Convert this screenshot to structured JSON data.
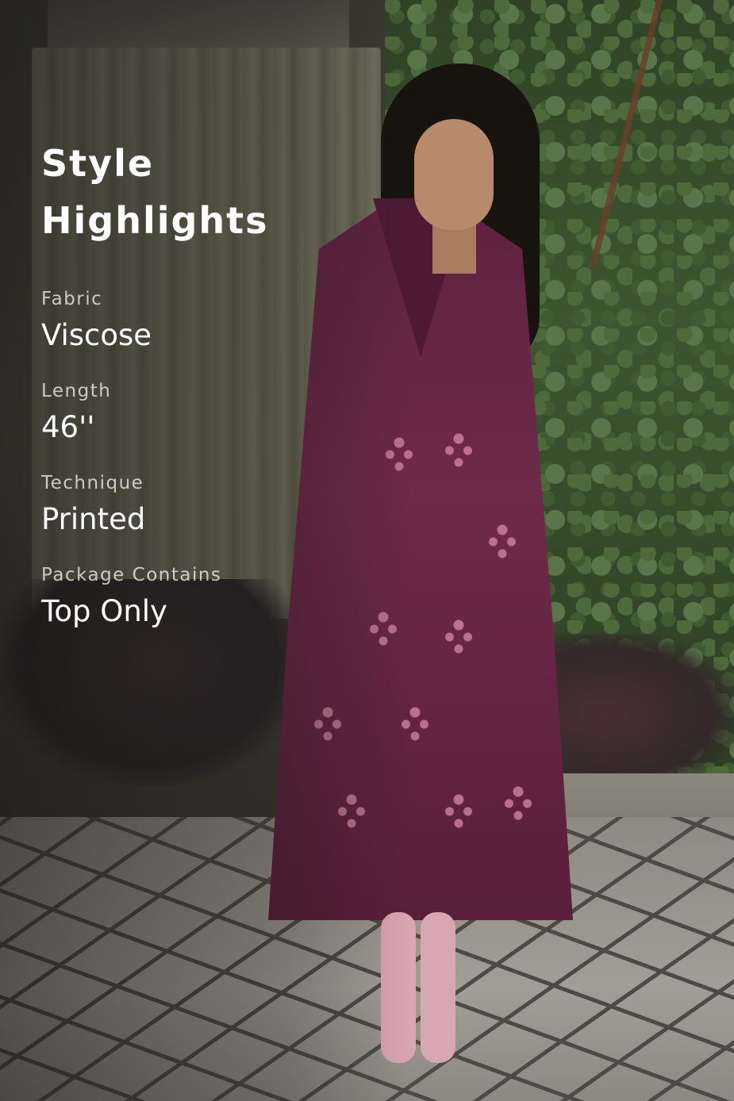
{
  "highlights": {
    "title_line1": "Style",
    "title_line2": "Highlights",
    "specs": [
      {
        "label": "Fabric",
        "value": "Viscose"
      },
      {
        "label": "Length",
        "value": "46''"
      },
      {
        "label": "Technique",
        "value": "Printed"
      },
      {
        "label": "Package Contains",
        "value": "Top Only"
      }
    ]
  },
  "colors": {
    "text_primary": "#ffffff",
    "kurta": "#6e2a49",
    "motif": "#d88aa4"
  }
}
